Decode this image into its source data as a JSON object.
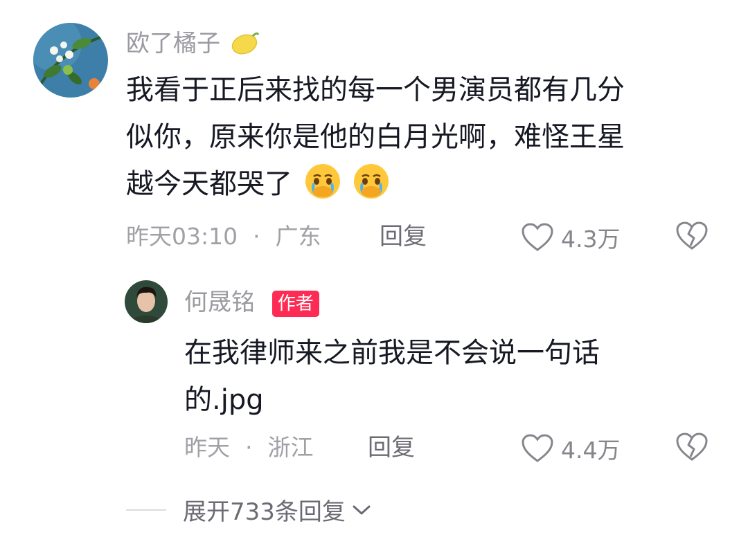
{
  "comment": {
    "username": "欧了橘子",
    "username_emoji": "lemon-icon",
    "lines": [
      "我看于正后来找的每一个男演员都有几分",
      "似你，原来你是他的白月光啊，难怪王星",
      "越今天都哭了"
    ],
    "emojis": [
      "crying-face-icon",
      "crying-face-icon"
    ],
    "time": "昨天03:10",
    "separator": "·",
    "location": "广东",
    "reply_label": "回复",
    "likes": "4.3万"
  },
  "reply": {
    "username": "何晟铭",
    "badge": "作者",
    "lines": [
      "在我律师来之前我是不会说一句话",
      "的.jpg"
    ],
    "time": "昨天",
    "separator": "·",
    "location": "浙江",
    "reply_label": "回复",
    "likes": "4.4万"
  },
  "expand_label": "展开733条回复",
  "colors": {
    "accent": "#fe2c55",
    "meta": "#a0a0a6",
    "text": "#161823"
  }
}
